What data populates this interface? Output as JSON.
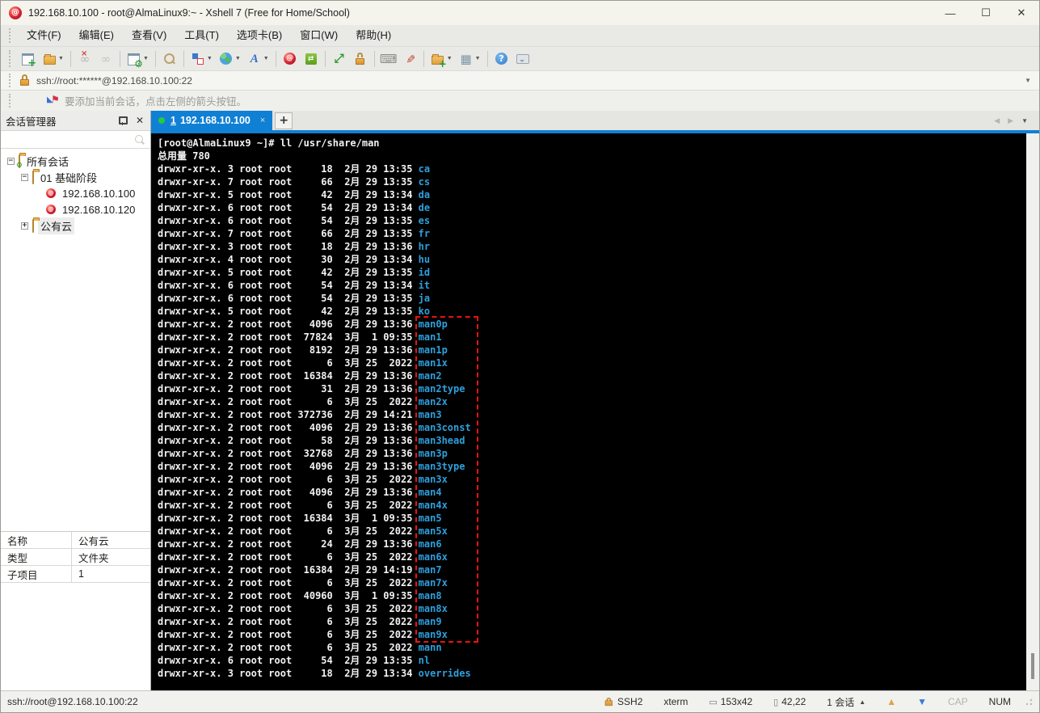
{
  "window": {
    "title": "192.168.10.100 - root@AlmaLinux9:~ - Xshell 7 (Free for Home/School)",
    "controls": {
      "minimize": "—",
      "maximize": "☐",
      "close": "✕"
    }
  },
  "menu": {
    "items": [
      {
        "label": "文件(F)"
      },
      {
        "label": "编辑(E)"
      },
      {
        "label": "查看(V)"
      },
      {
        "label": "工具(T)"
      },
      {
        "label": "选项卡(B)"
      },
      {
        "label": "窗口(W)"
      },
      {
        "label": "帮助(H)"
      }
    ]
  },
  "toolbar": {
    "items": [
      {
        "name": "new-session-icon",
        "shape": "window-plus"
      },
      {
        "name": "open-folder-icon",
        "shape": "folder-o",
        "dropdown": true
      },
      {
        "sep": true
      },
      {
        "name": "disconnect-icon",
        "shape": "broken-link"
      },
      {
        "name": "reconnect-icon",
        "shape": "chain-link"
      },
      {
        "sep": true
      },
      {
        "name": "session-properties-icon",
        "shape": "window-gear",
        "dropdown": true
      },
      {
        "sep": true
      },
      {
        "name": "find-icon",
        "shape": "magnifier"
      },
      {
        "sep": true
      },
      {
        "name": "compose-layout-icon",
        "shape": "blocks",
        "dropdown": true
      },
      {
        "name": "encoding-globe-icon",
        "shape": "globe",
        "dropdown": true
      },
      {
        "name": "font-icon",
        "shape": "font-a",
        "dropdown": true
      },
      {
        "sep": true
      },
      {
        "name": "xshell-icon",
        "shape": "xshell-ball"
      },
      {
        "name": "xftp-icon",
        "shape": "xftp-box"
      },
      {
        "sep": true
      },
      {
        "name": "fullscreen-icon",
        "shape": "fullscreen"
      },
      {
        "name": "lock-screen-icon",
        "shape": "lock"
      },
      {
        "sep": true
      },
      {
        "name": "virtual-keyboard-icon",
        "shape": "keyboard"
      },
      {
        "name": "highlight-pen-icon",
        "shape": "pen"
      },
      {
        "sep": true
      },
      {
        "name": "new-file-icon",
        "shape": "folder-plus",
        "dropdown": true
      },
      {
        "name": "tile-layout-icon",
        "shape": "grid",
        "dropdown": true
      },
      {
        "sep": true
      },
      {
        "name": "help-icon",
        "shape": "help"
      },
      {
        "name": "feedback-icon",
        "shape": "chat"
      }
    ]
  },
  "address": {
    "value": "ssh://root:******@192.168.10.100:22"
  },
  "notice": {
    "text": "要添加当前会话，点击左侧的箭头按钮。"
  },
  "session_manager": {
    "title": "会话管理器",
    "tree": [
      {
        "label": "所有会话",
        "depth": 0,
        "expander": "minus",
        "icon": "folder-gear"
      },
      {
        "label": "01 基础阶段",
        "depth": 1,
        "expander": "minus",
        "icon": "folder"
      },
      {
        "label": "192.168.10.100",
        "depth": 2,
        "expander": "none",
        "icon": "session"
      },
      {
        "label": "192.168.10.120",
        "depth": 2,
        "expander": "none",
        "icon": "session"
      },
      {
        "label": "公有云",
        "depth": 1,
        "expander": "plus",
        "icon": "folder",
        "selected": true
      }
    ],
    "properties": [
      {
        "label": "名称",
        "value": "公有云"
      },
      {
        "label": "类型",
        "value": "文件夹"
      },
      {
        "label": "子项目",
        "value": "1"
      }
    ]
  },
  "tabs": {
    "active": {
      "number": "1",
      "label": "192.168.10.100",
      "close": "×"
    },
    "new_tab": "+",
    "nav": {
      "prev": "◀",
      "next": "▶",
      "list": "▼"
    }
  },
  "terminal": {
    "prompt_line": "[root@AlmaLinux9 ~]# ll /usr/share/man",
    "total_line": "总用量 780",
    "listing": {
      "perm": "drwxr-xr-x.",
      "owner": "root",
      "group": "root",
      "entries": [
        [
          3,
          18,
          "2月",
          29,
          "13:35",
          "ca"
        ],
        [
          7,
          66,
          "2月",
          29,
          "13:35",
          "cs"
        ],
        [
          5,
          42,
          "2月",
          29,
          "13:34",
          "da"
        ],
        [
          6,
          54,
          "2月",
          29,
          "13:34",
          "de"
        ],
        [
          6,
          54,
          "2月",
          29,
          "13:35",
          "es"
        ],
        [
          7,
          66,
          "2月",
          29,
          "13:35",
          "fr"
        ],
        [
          3,
          18,
          "2月",
          29,
          "13:36",
          "hr"
        ],
        [
          4,
          30,
          "2月",
          29,
          "13:34",
          "hu"
        ],
        [
          5,
          42,
          "2月",
          29,
          "13:35",
          "id"
        ],
        [
          6,
          54,
          "2月",
          29,
          "13:34",
          "it"
        ],
        [
          6,
          54,
          "2月",
          29,
          "13:35",
          "ja"
        ],
        [
          5,
          42,
          "2月",
          29,
          "13:35",
          "ko"
        ],
        [
          2,
          4096,
          "2月",
          29,
          "13:36",
          "man0p"
        ],
        [
          2,
          77824,
          "3月",
          1,
          "09:35",
          "man1"
        ],
        [
          2,
          8192,
          "2月",
          29,
          "13:36",
          "man1p"
        ],
        [
          2,
          6,
          "3月",
          25,
          "2022",
          "man1x"
        ],
        [
          2,
          16384,
          "2月",
          29,
          "13:36",
          "man2"
        ],
        [
          2,
          31,
          "2月",
          29,
          "13:36",
          "man2type"
        ],
        [
          2,
          6,
          "3月",
          25,
          "2022",
          "man2x"
        ],
        [
          2,
          372736,
          "2月",
          29,
          "14:21",
          "man3"
        ],
        [
          2,
          4096,
          "2月",
          29,
          "13:36",
          "man3const"
        ],
        [
          2,
          58,
          "2月",
          29,
          "13:36",
          "man3head"
        ],
        [
          2,
          32768,
          "2月",
          29,
          "13:36",
          "man3p"
        ],
        [
          2,
          4096,
          "2月",
          29,
          "13:36",
          "man3type"
        ],
        [
          2,
          6,
          "3月",
          25,
          "2022",
          "man3x"
        ],
        [
          2,
          4096,
          "2月",
          29,
          "13:36",
          "man4"
        ],
        [
          2,
          6,
          "3月",
          25,
          "2022",
          "man4x"
        ],
        [
          2,
          16384,
          "3月",
          1,
          "09:35",
          "man5"
        ],
        [
          2,
          6,
          "3月",
          25,
          "2022",
          "man5x"
        ],
        [
          2,
          24,
          "2月",
          29,
          "13:36",
          "man6"
        ],
        [
          2,
          6,
          "3月",
          25,
          "2022",
          "man6x"
        ],
        [
          2,
          16384,
          "2月",
          29,
          "14:19",
          "man7"
        ],
        [
          2,
          6,
          "3月",
          25,
          "2022",
          "man7x"
        ],
        [
          2,
          40960,
          "3月",
          1,
          "09:35",
          "man8"
        ],
        [
          2,
          6,
          "3月",
          25,
          "2022",
          "man8x"
        ],
        [
          2,
          6,
          "3月",
          25,
          "2022",
          "man9"
        ],
        [
          2,
          6,
          "3月",
          25,
          "2022",
          "man9x"
        ],
        [
          2,
          6,
          "3月",
          25,
          "2022",
          "mann"
        ],
        [
          6,
          54,
          "2月",
          29,
          "13:35",
          "nl"
        ],
        [
          3,
          18,
          "2月",
          29,
          "13:34",
          "overrides"
        ]
      ]
    },
    "highlight": {
      "from": "man0p",
      "to": "man9x",
      "color": "#ee1111"
    },
    "dir_color": "#2f9fdc"
  },
  "status_bar": {
    "left": "ssh://root@192.168.10.100:22",
    "right": [
      {
        "name": "protocol",
        "icon": "lock",
        "label": "SSH2"
      },
      {
        "name": "terminal-type",
        "label": "xterm"
      },
      {
        "name": "screen-size",
        "icon": "resize",
        "label": "153x42"
      },
      {
        "name": "cursor-position",
        "icon": "caret",
        "label": "42,22"
      },
      {
        "name": "session-count",
        "label": "1 会话",
        "caret": true,
        "interactable": true
      },
      {
        "name": "scroll-top",
        "icon": "up",
        "interactable": true
      },
      {
        "name": "scroll-bottom",
        "icon": "down",
        "interactable": true
      },
      {
        "name": "caps-lock",
        "label": "CAP",
        "dim": true
      },
      {
        "name": "num-lock",
        "label": "NUM"
      }
    ]
  }
}
